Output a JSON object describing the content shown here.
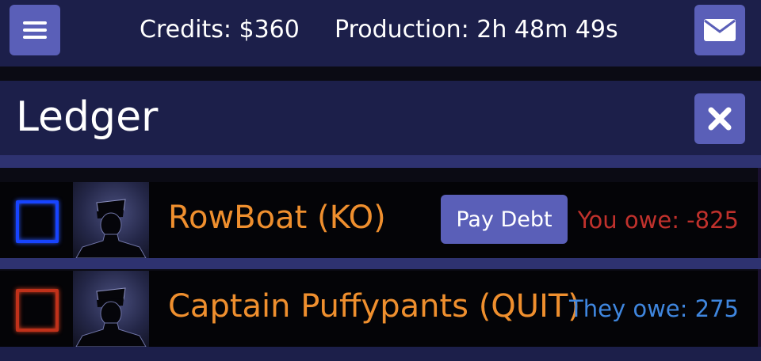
{
  "topbar": {
    "credits_text": "Credits: $360",
    "production_text": "Production: 2h 48m 49s",
    "menu_icon": "hamburger-menu-icon",
    "mail_icon": "envelope-icon"
  },
  "panel": {
    "title": "Ledger",
    "close_icon": "close-x-icon"
  },
  "ledger": {
    "rows": [
      {
        "name": "RowBoat (KO)",
        "status_color": "#1744ff",
        "action_label": "Pay Debt",
        "balance_text": "You owe: -825",
        "balance_color": "#c0312c"
      },
      {
        "name": "Captain Puffypants (QUIT)",
        "status_color": "#c0311a",
        "balance_text": "They owe: 275",
        "balance_color": "#3f86de"
      }
    ]
  },
  "colors": {
    "panel_bg": "#1c1f4a",
    "accent_button": "#5a5fb8",
    "player_name": "#ef8f2e"
  }
}
